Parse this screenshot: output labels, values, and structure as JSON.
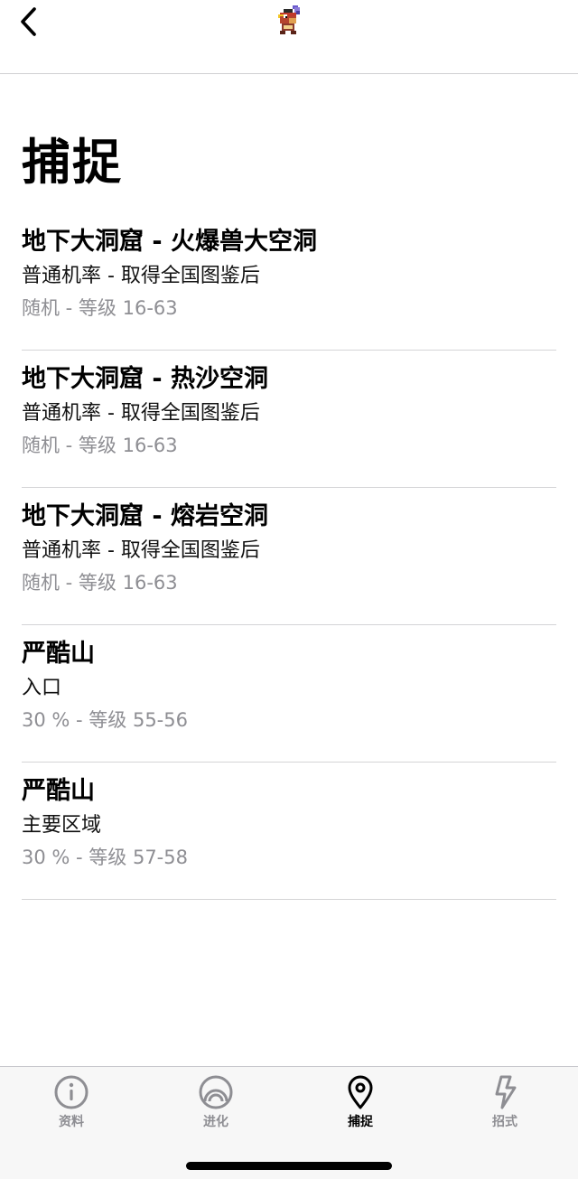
{
  "nav": {
    "back_icon": "chevron-left-icon",
    "sprite_icon": "pokemon-sprite-icon"
  },
  "page": {
    "title": "捕捉"
  },
  "encounters": [
    {
      "location": "地下大洞窟 - 火爆兽大空洞",
      "method": "普通机率 - 取得全国图鉴后",
      "rate": "随机 - 等级 16-63"
    },
    {
      "location": "地下大洞窟 - 热沙空洞",
      "method": "普通机率 - 取得全国图鉴后",
      "rate": "随机 - 等级 16-63"
    },
    {
      "location": "地下大洞窟 - 熔岩空洞",
      "method": "普通机率 - 取得全国图鉴后",
      "rate": "随机 - 等级 16-63"
    },
    {
      "location": "严酷山",
      "method": "入口",
      "rate": "30 % - 等级 55-56"
    },
    {
      "location": "严酷山",
      "method": "主要区域",
      "rate": "30 % - 等级 57-58"
    }
  ],
  "tabbar": {
    "tabs": [
      {
        "label": "资料",
        "icon": "info-icon",
        "active": false
      },
      {
        "label": "进化",
        "icon": "evolution-icon",
        "active": false
      },
      {
        "label": "捕捉",
        "icon": "location-pin-icon",
        "active": true
      },
      {
        "label": "招式",
        "icon": "lightning-bolt-icon",
        "active": false
      }
    ]
  },
  "colors": {
    "secondary_text": "#8e8e93",
    "divider": "#d4d4d6",
    "tabbar_bg": "#f7f7f7",
    "active_tab": "#000000",
    "inactive_tab": "#8e8e93"
  }
}
